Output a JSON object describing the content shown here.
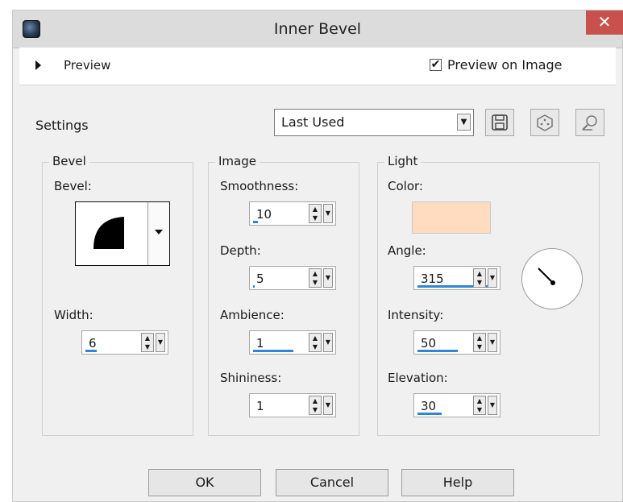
{
  "window": {
    "title": "Inner Bevel",
    "close_glyph": "✕"
  },
  "preview": {
    "label": "Preview",
    "preview_on_image_label": "Preview on Image",
    "preview_on_image_checked": true
  },
  "settings": {
    "label": "Settings",
    "preset_value": "Last Used"
  },
  "toolbar_icons": [
    "save-preset-icon",
    "reset-dice-icon",
    "manage-presets-icon"
  ],
  "bevel": {
    "group_title": "Bevel",
    "bevel_label": "Bevel:",
    "width_label": "Width:",
    "width_value": "6"
  },
  "image": {
    "group_title": "Image",
    "smoothness_label": "Smoothness:",
    "smoothness_value": "10",
    "depth_label": "Depth:",
    "depth_value": "5",
    "ambience_label": "Ambience:",
    "ambience_value": "1",
    "shininess_label": "Shininess:",
    "shininess_value": "1"
  },
  "light": {
    "group_title": "Light",
    "color_label": "Color:",
    "color": "#ffdcc0",
    "angle_label": "Angle:",
    "angle_value": "315",
    "intensity_label": "Intensity:",
    "intensity_value": "50",
    "elevation_label": "Elevation:",
    "elevation_value": "30"
  },
  "buttons": {
    "ok": "OK",
    "cancel": "Cancel",
    "help": "Help"
  },
  "colors": {
    "close": "#c7524d",
    "accent": "#2f86d8"
  }
}
